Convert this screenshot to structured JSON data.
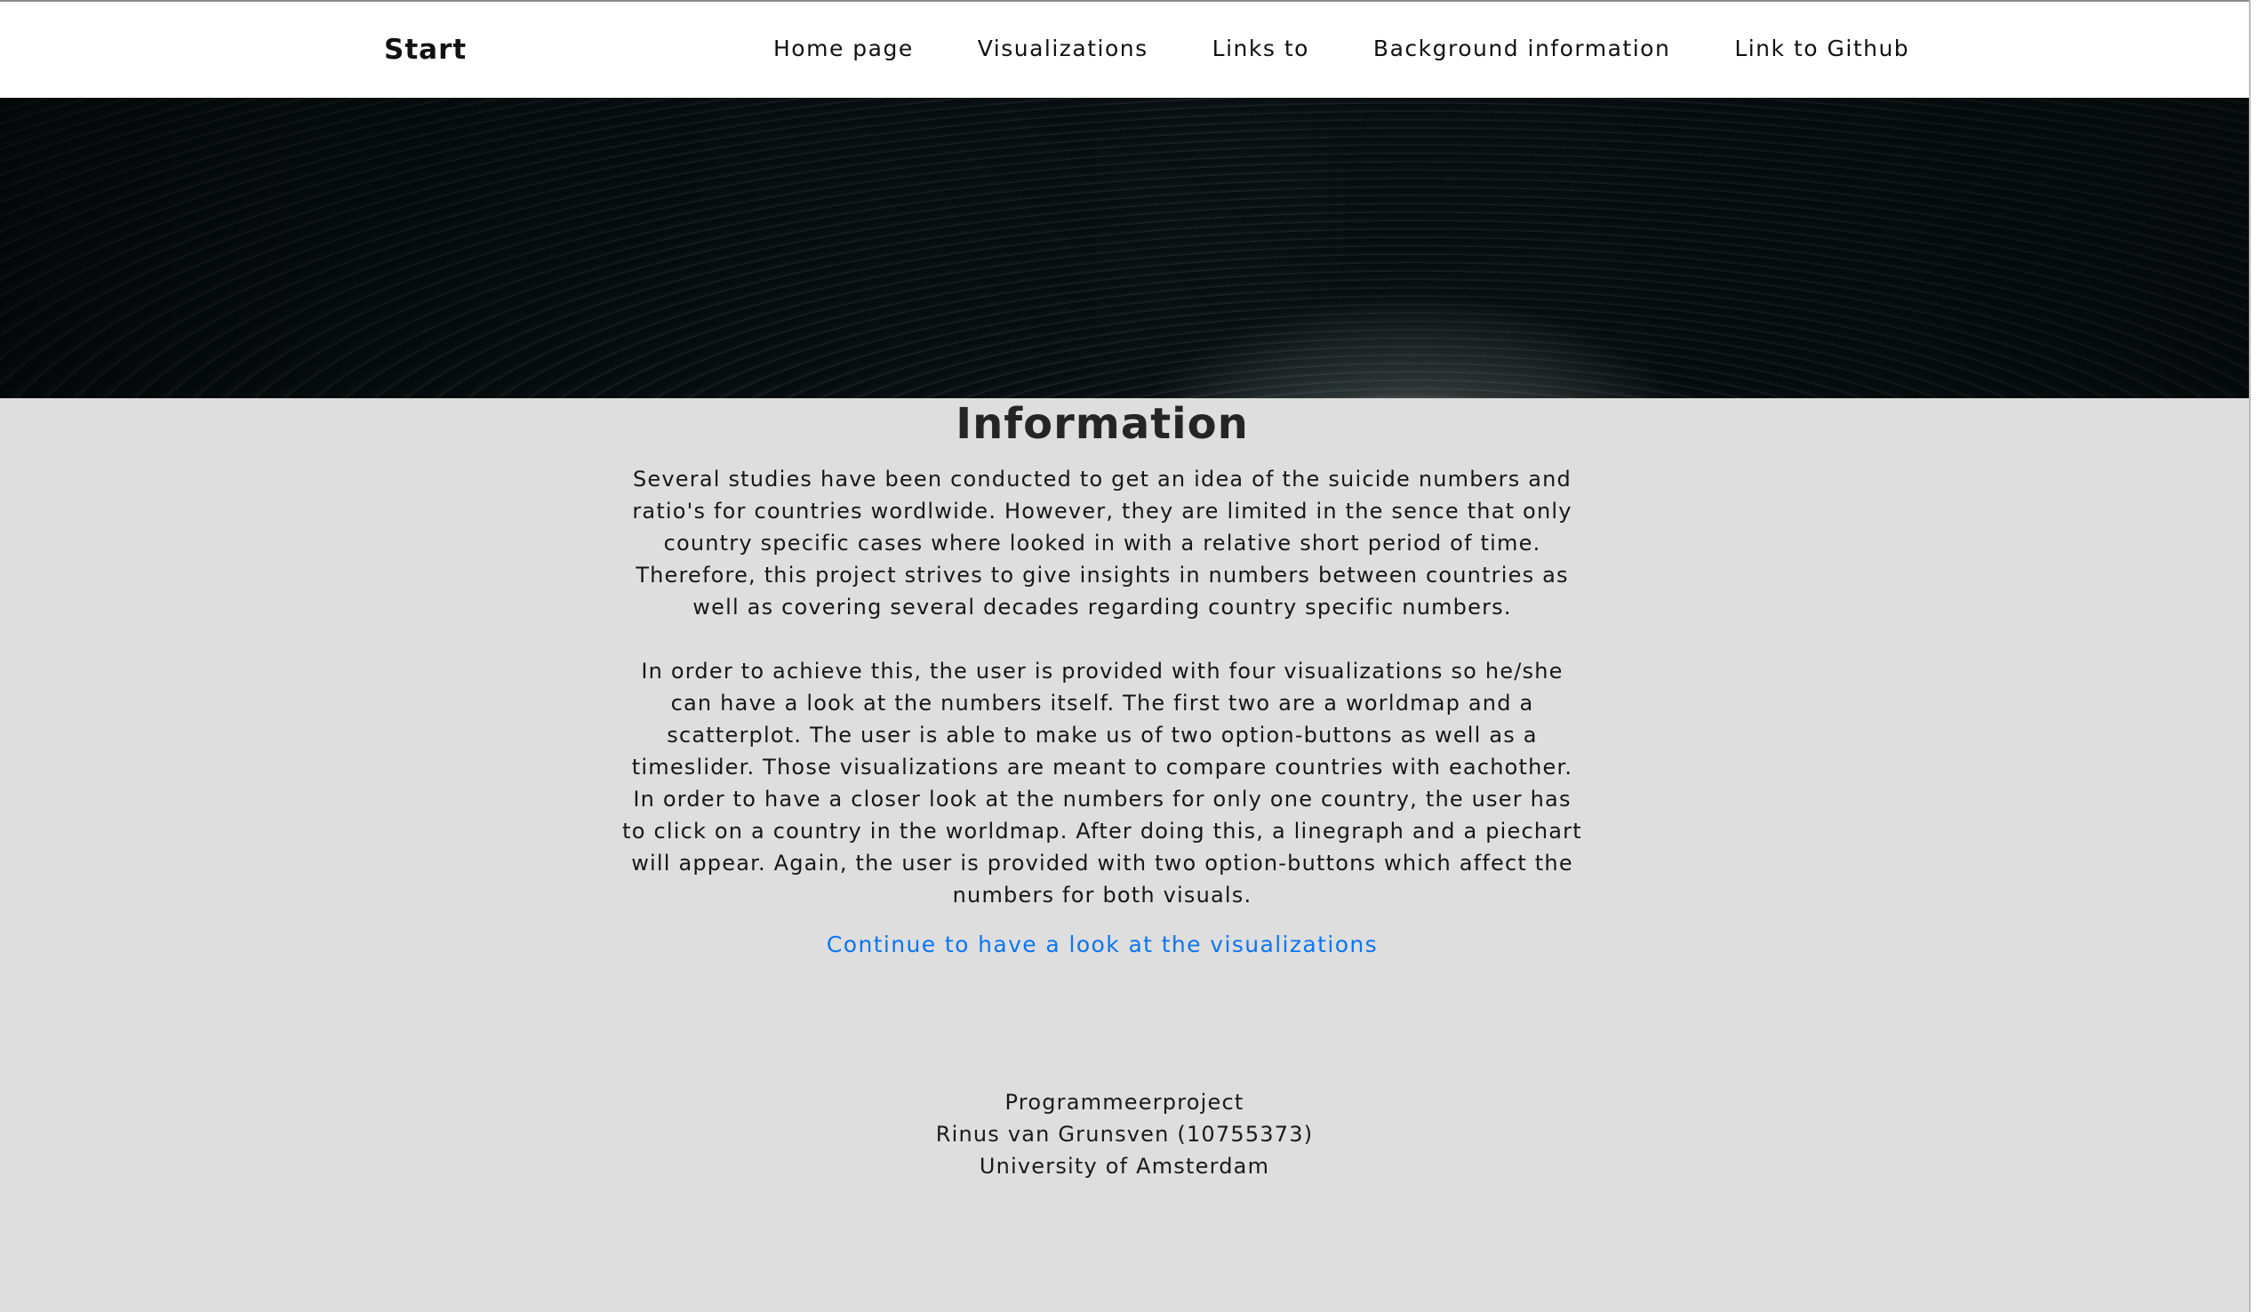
{
  "navbar": {
    "brand": "Start",
    "links": [
      "Home page",
      "Visualizations",
      "Links to",
      "Background information",
      "Link to Github"
    ]
  },
  "main": {
    "title": "Information",
    "paragraphs": [
      "Several studies have been conducted to get an idea of the suicide numbers and ratio's for countries wordlwide. However, they are limited in the sence that only country specific cases where looked in with a relative short period of time. Therefore, this project strives to give insights in numbers between countries as well as covering several decades regarding country specific numbers.",
      "In order to achieve this, the user is provided with four visualizations so he/she can have a look at the numbers itself. The first two are a worldmap and a scatterplot. The user is able to make us of two option-buttons as well as a timeslider. Those visualizations are meant to compare countries with eachother. In order to have a closer look at the numbers for only one country, the user has to click on a country in the worldmap. After doing this, a linegraph and a piechart will appear. Again, the user is provided with two option-buttons which affect the numbers for both visuals."
    ],
    "continue_link": "Continue to have a look at the visualizations"
  },
  "footer": {
    "lines": [
      "Programmeerproject",
      "Rinus van Grunsven (10755373)",
      "University of Amsterdam"
    ]
  },
  "colors": {
    "page_background": "#dedede",
    "navbar_background": "#ffffff",
    "link": "#0a75f0",
    "text": "#171717"
  }
}
